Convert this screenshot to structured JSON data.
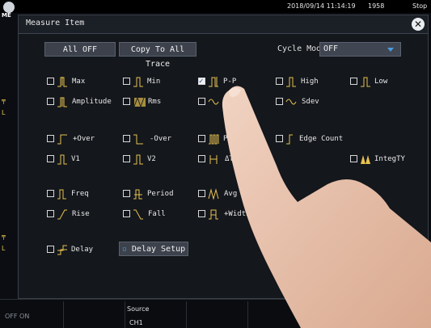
{
  "status": {
    "logo": "ME",
    "date": "2018/09/14 11:14:19",
    "count": "1958",
    "state": "Stop"
  },
  "dialog": {
    "title": "Measure Item",
    "buttons": {
      "all_off": "All OFF",
      "copy_all": "Copy To All Trace"
    },
    "cycle_mode": {
      "label": "Cycle Mode",
      "value": "OFF"
    },
    "items": [
      {
        "label": "Max",
        "checked": false,
        "icon": "max-waveform-icon"
      },
      {
        "label": "Min",
        "checked": false,
        "icon": "min-waveform-icon"
      },
      {
        "label": "P-P",
        "checked": true,
        "icon": "peak-to-peak-waveform-icon"
      },
      {
        "label": "High",
        "checked": false,
        "icon": "high-waveform-icon"
      },
      {
        "label": "Low",
        "checked": false,
        "icon": "low-waveform-icon"
      },
      {
        "label": "Amplitude",
        "checked": false,
        "icon": "amplitude-waveform-icon"
      },
      {
        "label": "Rms",
        "checked": false,
        "icon": "rms-waveform-icon"
      },
      {
        "label": "",
        "checked": false,
        "icon": "mean-waveform-icon"
      },
      {
        "label": "Sdev",
        "checked": false,
        "icon": "sdev-waveform-icon"
      },
      {
        "label": "+Over",
        "checked": false,
        "icon": "plus-over-waveform-icon"
      },
      {
        "label": "-Over",
        "checked": false,
        "icon": "minus-over-waveform-icon"
      },
      {
        "label": "Pulse Co",
        "checked": false,
        "icon": "pulse-count-waveform-icon"
      },
      {
        "label": "Edge Count",
        "checked": false,
        "icon": "edge-count-waveform-icon"
      },
      {
        "label": "V1",
        "checked": false,
        "icon": "v1-waveform-icon"
      },
      {
        "label": "V2",
        "checked": false,
        "icon": "v2-waveform-icon"
      },
      {
        "label": "ΔT",
        "checked": false,
        "icon": "delta-t-waveform-icon"
      },
      {
        "label": "IntegTY",
        "checked": false,
        "icon": "integ-ty-waveform-icon"
      },
      {
        "label": "Freq",
        "checked": false,
        "icon": "freq-waveform-icon"
      },
      {
        "label": "Period",
        "checked": false,
        "icon": "period-waveform-icon"
      },
      {
        "label": "Avg Freq",
        "checked": false,
        "icon": "avg-freq-waveform-icon"
      },
      {
        "label": "Rise",
        "checked": false,
        "icon": "rise-waveform-icon"
      },
      {
        "label": "Fall",
        "checked": false,
        "icon": "fall-waveform-icon"
      },
      {
        "label": "+Width",
        "checked": false,
        "icon": "plus-width-waveform-icon"
      },
      {
        "label": "Delay",
        "checked": false,
        "icon": "delay-waveform-icon"
      }
    ],
    "delay_setup": "Delay Setup"
  },
  "softkeys": {
    "off_on": "OFF   ON",
    "source_label": "Source",
    "source_value": "CH1"
  },
  "colors": {
    "accent": "#4a9be0",
    "dialog_bg": "#14171c",
    "button": "#3c414b",
    "icon": "#e6c24f"
  }
}
